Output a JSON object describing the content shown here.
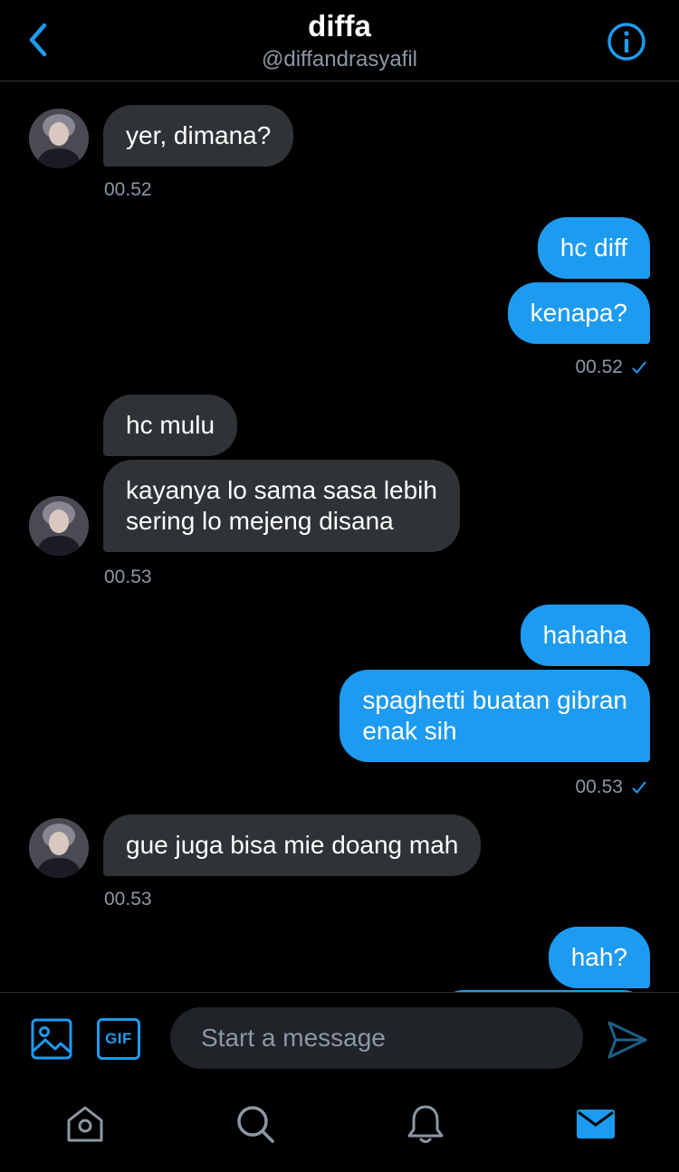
{
  "header": {
    "title": "diffa",
    "handle": "@diffandrasyafil"
  },
  "messages": {
    "m1": "yer, dimana?",
    "t1": "00.52",
    "m2": "hc diff",
    "m3": "kenapa?",
    "t2": "00.52",
    "m4": "hc mulu",
    "m5": "kayanya lo sama sasa lebih\nsering lo mejeng disana",
    "t3": "00.53",
    "m6": "hahaha",
    "m7": "spaghetti buatan gibran\nenak sih",
    "t4": "00.53",
    "m8": "gue juga bisa mie doang mah",
    "t5": "00.53",
    "m9": "hah?"
  },
  "composer": {
    "placeholder": "Start a message",
    "gif_label": "GIF"
  },
  "colors": {
    "accent": "#1d9bf0",
    "incoming_bubble": "#2f3336",
    "background": "#000000"
  }
}
